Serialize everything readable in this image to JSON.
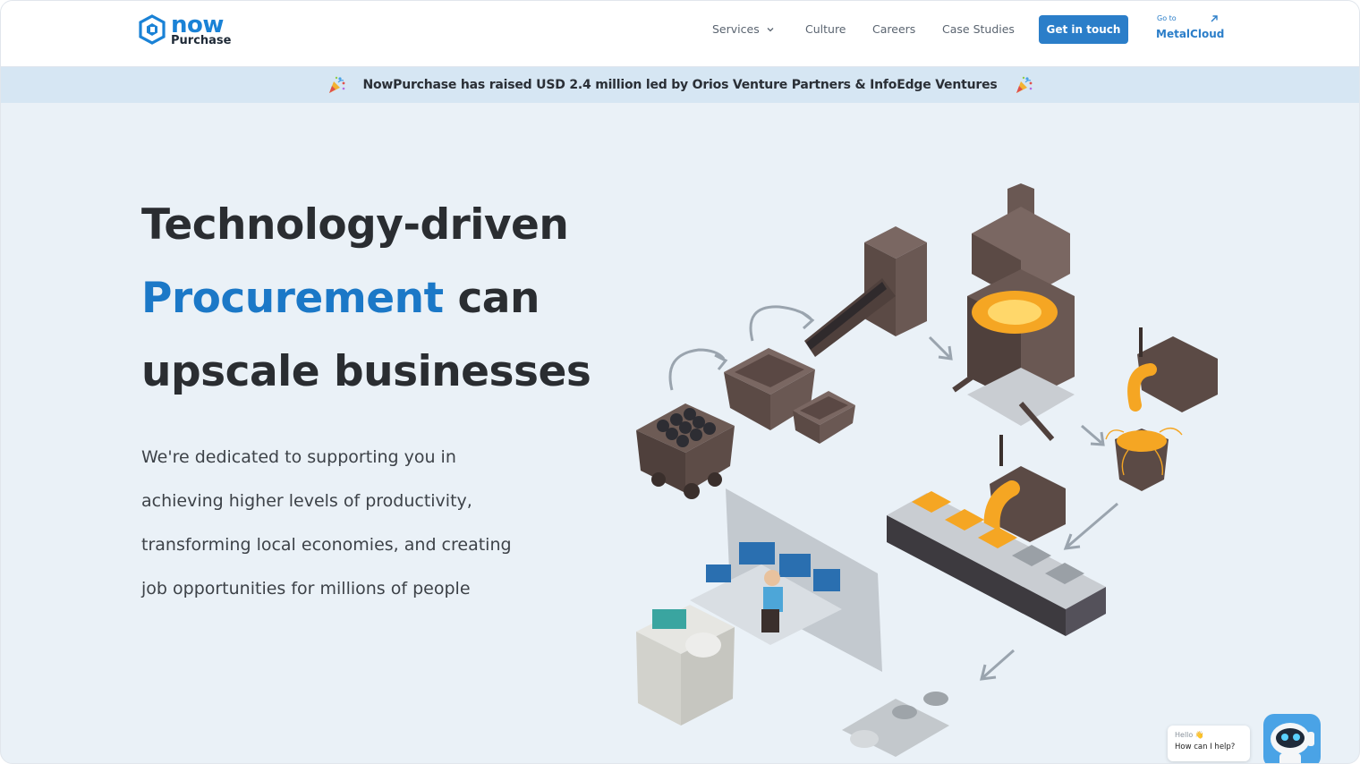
{
  "header": {
    "logo": {
      "word": "now",
      "sub": "Purchase"
    },
    "nav": [
      {
        "label": "Services",
        "has_dropdown": true,
        "icon": "chevron-down-icon"
      },
      {
        "label": "Culture"
      },
      {
        "label": "Careers"
      },
      {
        "label": "Case Studies"
      }
    ],
    "cta_label": "Get in touch",
    "metalcloud": {
      "small": "Go to",
      "label": "MetalCloud",
      "icon": "external-arrow-icon"
    }
  },
  "announcement": {
    "text": "NowPurchase has raised USD 2.4 million led by Orios Venture Partners & InfoEdge Ventures",
    "icon": "party-popper-icon"
  },
  "hero": {
    "title_line1": "Technology-driven",
    "title_highlight": "Procurement",
    "title_line2_rest": " can",
    "title_line3": "upscale businesses",
    "desc_lines": [
      "We're dedicated to supporting you in",
      "achieving higher levels of productivity,",
      "transforming local economies, and creating",
      "job opportunities for millions of people"
    ]
  },
  "chat": {
    "hello": "Hello 👋",
    "prompt": "How can I help?",
    "icon": "robot-icon"
  },
  "colors": {
    "brand_blue": "#1b78c7",
    "button_blue": "#2b7ec9",
    "banner_bg": "#d6e6f3",
    "page_bg": "#eaf1f7",
    "molten": "#f5a623"
  }
}
